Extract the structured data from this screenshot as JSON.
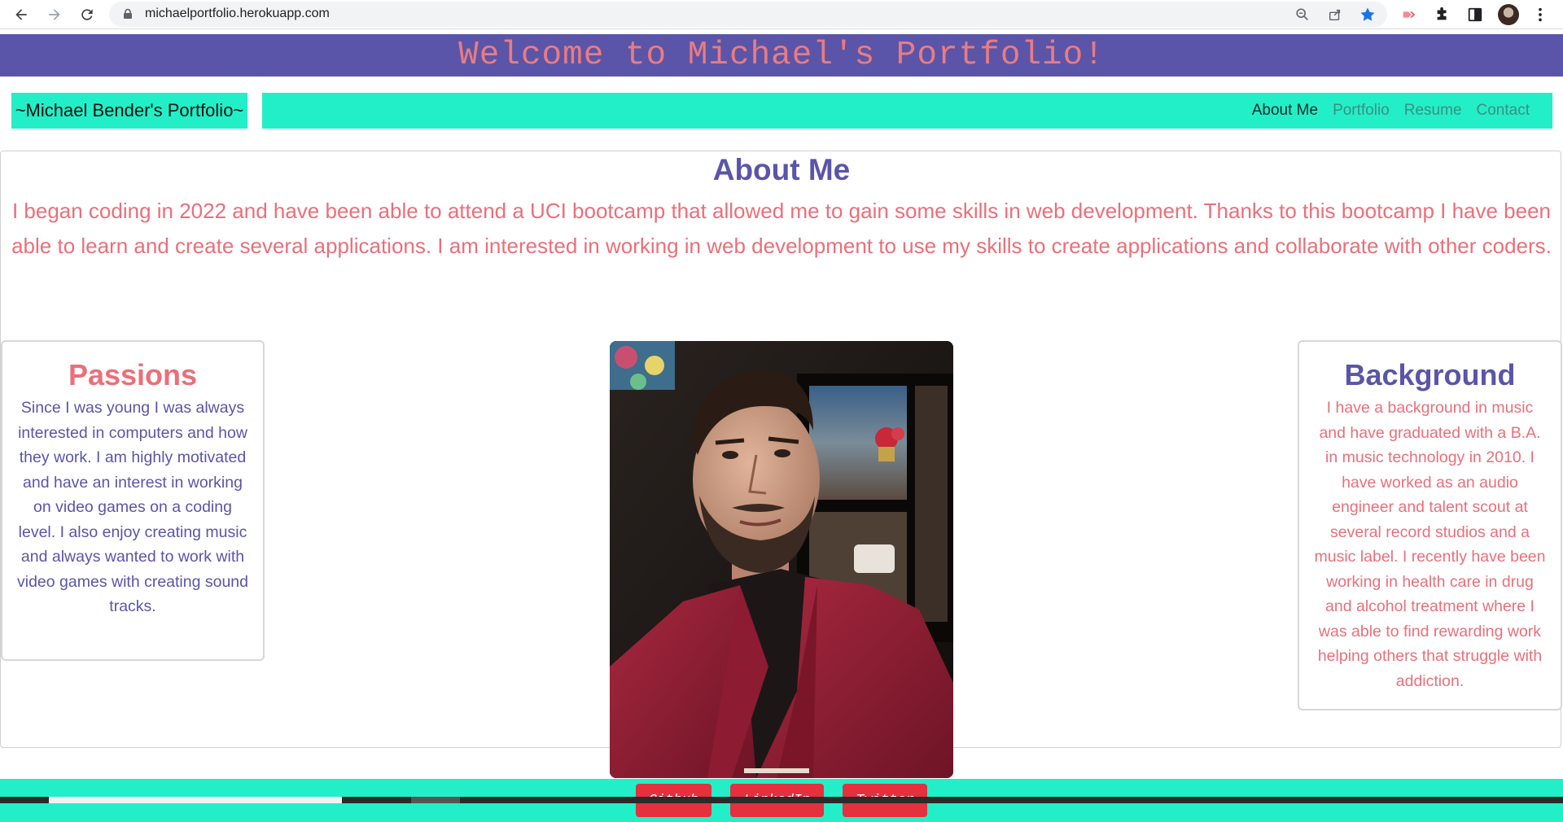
{
  "browser": {
    "url": "michaelportfolio.herokuapp.com"
  },
  "site": {
    "welcome": "Welcome to Michael's Portfolio!",
    "brand": "~Michael Bender's Portfolio~",
    "nav": [
      {
        "label": "About Me",
        "active": true
      },
      {
        "label": "Portfolio",
        "active": false
      },
      {
        "label": "Resume",
        "active": false
      },
      {
        "label": "Contact",
        "active": false
      }
    ]
  },
  "about": {
    "title": "About Me",
    "text": "I began coding in 2022 and have been able to attend a UCI bootcamp that allowed me to gain some skills in web development. Thanks to this bootcamp I have been able to learn and create several applications. I am interested in working in web development to use my skills to create applications and collaborate with other coders."
  },
  "passions": {
    "title": "Passions",
    "text": "Since I was young I was always interested in computers and how they work. I am highly motivated and have an interest in working on video games on a coding level. I also enjoy creating music and always wanted to work with video games with creating sound tracks."
  },
  "background": {
    "title": "Background",
    "text": "I have a background in music and have graduated with a B.A. in music technology in 2010. I have worked as an audio engineer and talent scout at several record studios and a music label. I recently have been working in health care in drug and alcohol treatment where I was able to find rewarding work helping others that struggle with addiction."
  },
  "footer": {
    "links": [
      "Github",
      "LinkedIn",
      "Twitter"
    ]
  },
  "colors": {
    "purple": "#5a55a8",
    "teal": "#22efc8",
    "coral": "#ea6f7a",
    "button_red": "#e5303e"
  }
}
